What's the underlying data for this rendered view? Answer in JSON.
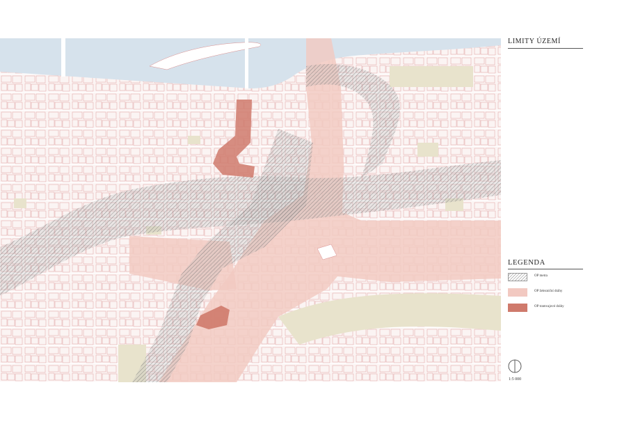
{
  "title": "LIMITY ÚZEMÍ",
  "legend": {
    "title": "LEGENDA",
    "items": [
      {
        "label": "OP metra",
        "color": "#5a5a5a",
        "pattern": "hatch"
      },
      {
        "label": "OP železniční dráhy",
        "color": "#f2c9c1",
        "pattern": "fill"
      },
      {
        "label": "OP tramvajové dráhy",
        "color": "#cf7a6c",
        "pattern": "fill"
      }
    ]
  },
  "scale": "1:5 000",
  "colors": {
    "river": "#d6e2ec",
    "parks": "#e8e3cc",
    "building_outline": "#d98c8c",
    "railway_zone": "#f2c9c1",
    "tram_zone": "#cf7a6c",
    "metro_zone": "#5a5a5a"
  }
}
